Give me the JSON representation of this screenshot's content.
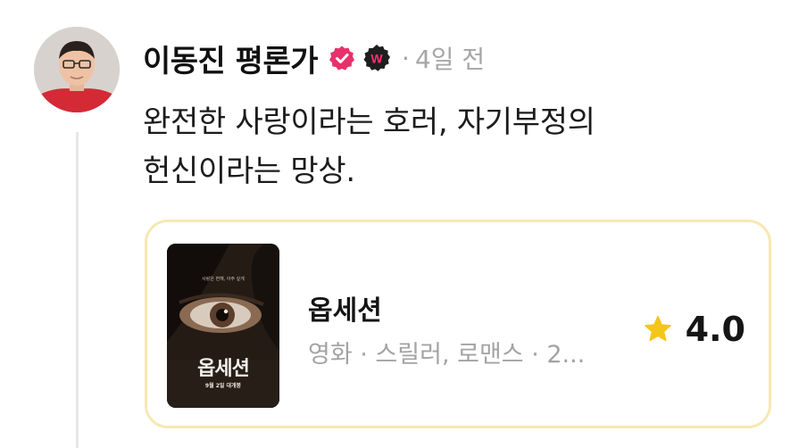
{
  "post": {
    "author": "이동진 평론가",
    "time_ago": "4일 전",
    "separator": "·",
    "body_lines": [
      "완전한 사랑이라는 호러, 자기부정의",
      "헌신이라는 망상."
    ]
  },
  "card": {
    "title": "옵세션",
    "subtitle": "영화 · 스릴러, 로맨스 · 2...",
    "rating": "4.0",
    "poster": {
      "title": "옵세션",
      "date": "9월 2일 대개봉",
      "tagline": "사랑은 변해, 아주 깊게"
    }
  },
  "colors": {
    "verified": "#e8316b",
    "w_badge_bg": "#1e1e1e",
    "w_badge_letter": "#ff2e74",
    "star": "#f5c518",
    "card_border": "#f7e8b2"
  },
  "icons": {
    "verified": "verified-check-icon",
    "badge": "w-badge-icon",
    "rating": "star-icon"
  }
}
